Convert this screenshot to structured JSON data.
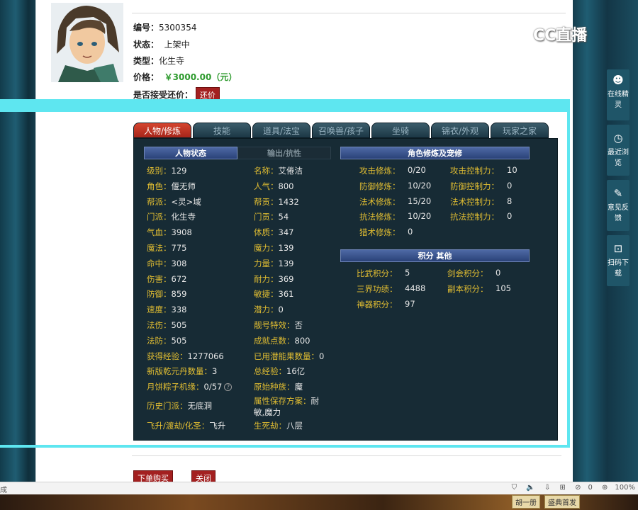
{
  "watermark": "CC直播",
  "item": {
    "id_label": "编号：",
    "id_value": "5300354",
    "status_label": "状态：",
    "status_value": "上架中",
    "type_label": "类型：",
    "type_value": "化生寺",
    "price_label": "价格：",
    "price_value": "￥3000.00（元）",
    "counter_label": "是否接受还价：",
    "counter_button": "还价"
  },
  "tabs": [
    "人物/修炼",
    "技能",
    "道具/法宝",
    "召唤兽/孩子",
    "坐骑",
    "锦衣/外观",
    "玩家之家"
  ],
  "sections": {
    "char_status": "人物状态",
    "output_resist": "输出/抗性",
    "cultivation": "角色修炼及宠修",
    "points_other": "积分 其他"
  },
  "stats_left": [
    {
      "k": "级别：",
      "v": "129"
    },
    {
      "k": "角色：",
      "v": "偃无师"
    },
    {
      "k": "帮派：",
      "v": "<灵>域"
    },
    {
      "k": "门派：",
      "v": "化生寺"
    },
    {
      "k": "气血：",
      "v": "3908"
    },
    {
      "k": "魔法：",
      "v": "775"
    },
    {
      "k": "命中：",
      "v": "308"
    },
    {
      "k": "伤害：",
      "v": "672"
    },
    {
      "k": "防御：",
      "v": "859"
    },
    {
      "k": "速度：",
      "v": "338"
    },
    {
      "k": "法伤：",
      "v": "505"
    },
    {
      "k": "法防：",
      "v": "505"
    },
    {
      "k": "获得经验：",
      "v": "1277066"
    },
    {
      "k": "新版乾元丹数量：",
      "v": "3"
    },
    {
      "k": "月饼粽子机缘：",
      "v": "0/57"
    },
    {
      "k": "历史门派：",
      "v": "无底洞"
    },
    {
      "k": "飞升/渡劫/化圣：",
      "v": "飞升"
    }
  ],
  "stats_mid": [
    {
      "k": "名称：",
      "v": "艾倦洁"
    },
    {
      "k": "人气：",
      "v": "800"
    },
    {
      "k": "帮贡：",
      "v": "1432"
    },
    {
      "k": "门贡：",
      "v": "54"
    },
    {
      "k": "体质：",
      "v": "347"
    },
    {
      "k": "魔力：",
      "v": "139"
    },
    {
      "k": "力量：",
      "v": "139"
    },
    {
      "k": "耐力：",
      "v": "369"
    },
    {
      "k": "敏捷：",
      "v": "361"
    },
    {
      "k": "潜力：",
      "v": "0"
    },
    {
      "k": "靓号特效：",
      "v": "否"
    },
    {
      "k": "成就点数：",
      "v": "800"
    },
    {
      "k": "已用潜能果数量：",
      "v": "0"
    },
    {
      "k": "总经验：",
      "v": "16亿"
    },
    {
      "k": "原始种族：",
      "v": "魔"
    },
    {
      "k": "属性保存方案：",
      "v": "耐",
      "v2": "敏,魔力"
    },
    {
      "k": "生死劫：",
      "v": "八层"
    }
  ],
  "cultivation_left": [
    {
      "k": "攻击修炼：",
      "v": "0/20"
    },
    {
      "k": "防御修炼：",
      "v": "10/20"
    },
    {
      "k": "法术修炼：",
      "v": "15/20"
    },
    {
      "k": "抗法修炼：",
      "v": "10/20"
    },
    {
      "k": "猎术修炼：",
      "v": "0"
    }
  ],
  "cultivation_right": [
    {
      "k": "攻击控制力：",
      "v": "10"
    },
    {
      "k": "防御控制力：",
      "v": "0"
    },
    {
      "k": "法术控制力：",
      "v": "8"
    },
    {
      "k": "抗法控制力：",
      "v": "0"
    }
  ],
  "points_left": [
    {
      "k": "比武积分：",
      "v": "5"
    },
    {
      "k": "三界功绩：",
      "v": "4488"
    },
    {
      "k": "神器积分：",
      "v": "97"
    }
  ],
  "points_right": [
    {
      "k": "剑会积分：",
      "v": "0"
    },
    {
      "k": "副本积分：",
      "v": "105"
    }
  ],
  "buttons": {
    "buy": "下单购买",
    "close": "关闭"
  },
  "side": {
    "online": "在线精灵",
    "recent": "最近浏览",
    "feedback": "意见反馈",
    "scan": "扫码下载"
  },
  "statusbar": {
    "done": "成",
    "zoom": "100%",
    "count": "0"
  },
  "taskbar": {
    "badge1": "胡一册",
    "badge2": "盛典首发"
  }
}
